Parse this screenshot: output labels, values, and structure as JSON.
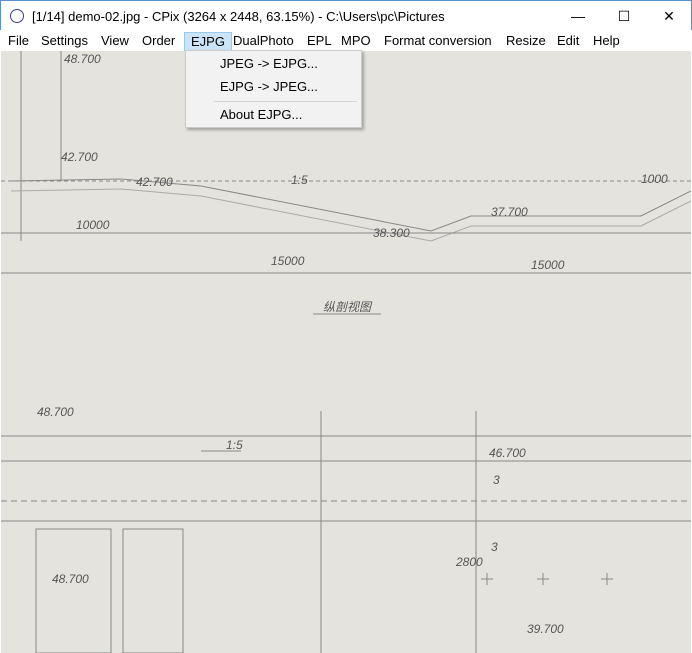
{
  "window": {
    "title": "[1/14] demo-02.jpg - CPix (3264 x 2448, 63.15%) - C:\\Users\\pc\\Pictures",
    "minimize": "—",
    "maximize": "☐",
    "close": "✕"
  },
  "menu": [
    "File",
    "Settings",
    "View",
    "Order",
    "EJPG",
    "DualPhoto",
    "EPL",
    "MPO",
    "Format conversion",
    "Resize",
    "Edit",
    "Help"
  ],
  "dropdown": {
    "items": [
      "JPEG -> EJPG...",
      "EJPG -> JPEG...",
      "About EJPG..."
    ]
  },
  "image": {
    "labels": [
      "48.700",
      "42.700",
      "42.700",
      "10000",
      "1:5",
      "38.300",
      "37.700",
      "15000",
      "15000",
      "纵剖视图",
      "48.700",
      "1:5",
      "46.700",
      "48.700",
      "3",
      "3",
      "2800",
      "39.700",
      "1000"
    ]
  }
}
